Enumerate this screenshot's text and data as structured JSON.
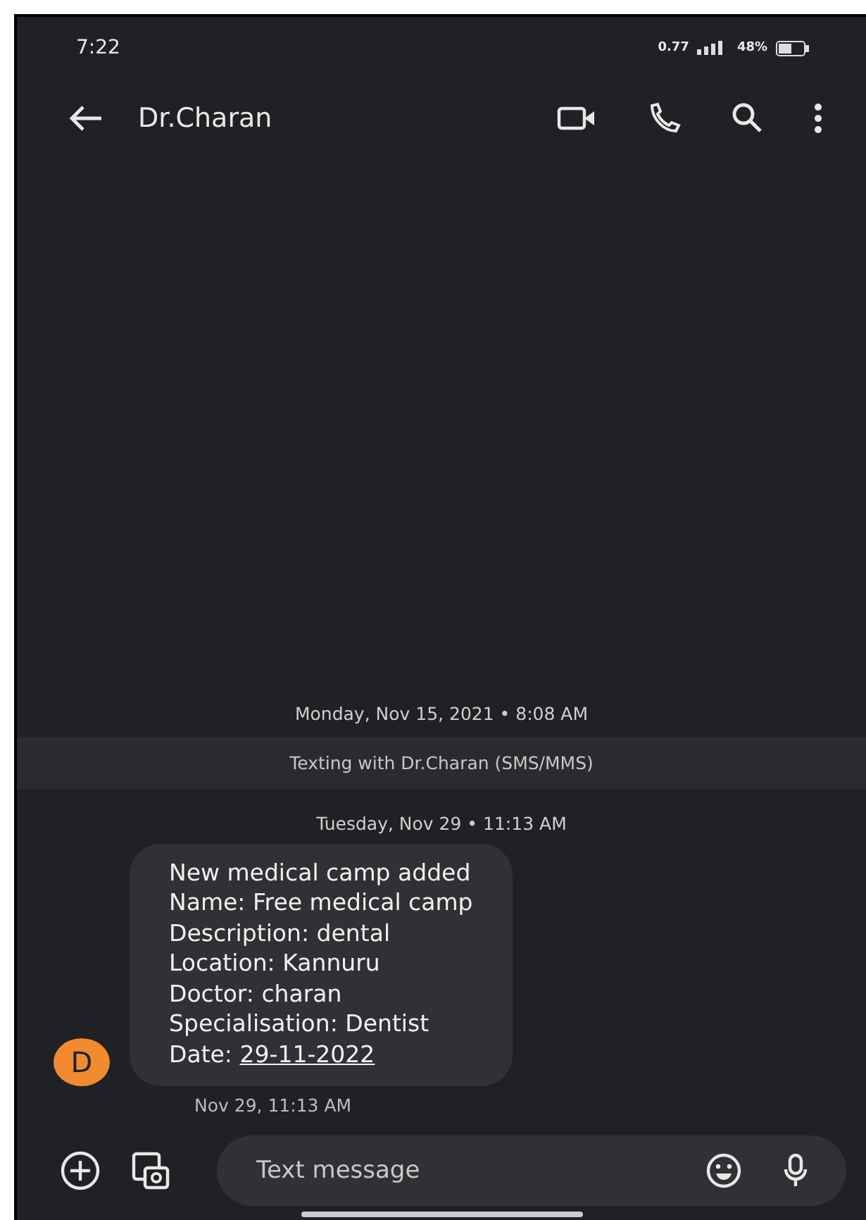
{
  "status_bar": {
    "time": "7:22",
    "net_speed": "0.77",
    "battery": "48%"
  },
  "header": {
    "title": "Dr.Charan"
  },
  "conversation": {
    "first_date": "Monday, Nov 15, 2021 • 8:08 AM",
    "banner": "Texting with Dr.Charan  (SMS/MMS)",
    "second_date": "Tuesday, Nov 29 • 11:13 AM"
  },
  "message": {
    "avatar": "D",
    "lines": [
      "New medical camp added",
      "Name: Free medical camp",
      "Description: dental",
      "Location: Kannuru",
      "Doctor: charan",
      "Specialisation: Dentist"
    ],
    "date_label": "Date:",
    "date_link": "29-11-2022",
    "timestamp": "Nov 29, 11:13 AM"
  },
  "composer": {
    "placeholder": "Text message"
  }
}
